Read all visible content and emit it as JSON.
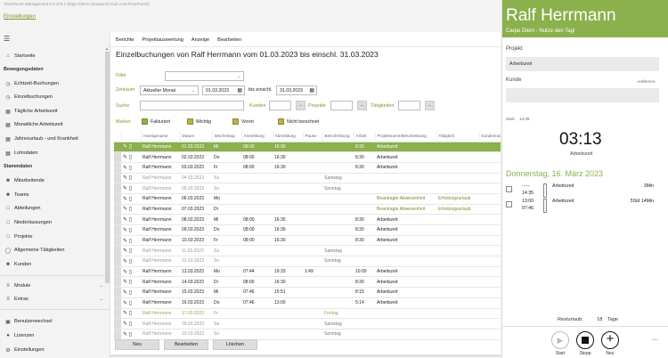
{
  "window": {
    "title": "TimePunch Management 5.0.373.1 (https://demo.timepunch-hub.com/TimePunch)",
    "app_link": "Einstellungen"
  },
  "sidebar": {
    "menu_icon": "hamburger-icon",
    "top_items": [
      {
        "label": "Startseite",
        "icon": "home-icon"
      }
    ],
    "section_bookings": "Bewegungsdaten",
    "booking_items": [
      {
        "label": "Echtzeit-Buchungen",
        "icon": "clock-icon"
      },
      {
        "label": "Einzelbuchungen",
        "icon": "clock-icon"
      },
      {
        "label": "Tägliche Arbeitszeit",
        "icon": "calendar-icon"
      },
      {
        "label": "Monatliche Arbeitszeit",
        "icon": "calendar-icon"
      },
      {
        "label": "Jahresurlaub - und Krankheit",
        "icon": "calendar-icon"
      },
      {
        "label": "Lohndaten",
        "icon": "table-icon"
      }
    ],
    "section_master": "Stammdaten",
    "master_items": [
      {
        "label": "Mitarbeitende",
        "icon": "person-icon"
      },
      {
        "label": "Teams",
        "icon": "team-icon"
      },
      {
        "label": "Abteilungen",
        "icon": "department-icon"
      },
      {
        "label": "Niederlassungen",
        "icon": "building-icon"
      },
      {
        "label": "Projekte",
        "icon": "folder-icon"
      },
      {
        "label": "Allgemeine Tätigkeiten",
        "icon": "activity-icon"
      },
      {
        "label": "Kunden",
        "icon": "customer-icon"
      }
    ],
    "expanders": [
      {
        "label": "Module",
        "icon": "module-icon"
      },
      {
        "label": "Extras",
        "icon": "extras-icon"
      }
    ],
    "bottom_items": [
      {
        "label": "Benutzerwechsel",
        "icon": "switch-user-icon"
      },
      {
        "label": "Lizenzen",
        "icon": "license-icon"
      },
      {
        "label": "Einstellungen",
        "icon": "gear-icon"
      }
    ]
  },
  "main": {
    "menu": [
      "Berichte",
      "Projektauswertung",
      "Anzeige",
      "Bearbeiten"
    ],
    "heading": "Einzelbuchungen von Ralf Herrmann vom 01.03.2023 bis einschl. 31.03.2023",
    "filter": {
      "filter_label": "Filter",
      "zeitraum_label": "Zeitraum",
      "zeitraum_value": "Aktueller Monat",
      "from_date": "01.03.2023",
      "until_label": "bis einschl.",
      "to_date": "31.03.2023",
      "search_label": "Suche",
      "kunden_label": "Kunden",
      "projekte_label": "Projekte",
      "taetigkeiten_label": "Tätigkeiten",
      "dots": "..."
    },
    "markers": {
      "label": "Marker",
      "items": [
        {
          "label": "Fakturiert",
          "style": "white"
        },
        {
          "label": "Wichtig",
          "style": "olive"
        },
        {
          "label": "Vorort",
          "style": "olive"
        },
        {
          "label": "Nicht berechnet",
          "style": "olive"
        }
      ]
    },
    "columns": [
      "",
      "",
      "Anzeigename",
      "Datum",
      "Wochentag",
      "Anmeldung",
      "Abmeldung",
      "Pause",
      "Beschreibung",
      "Arbeit",
      "Projektname/Beschreibung",
      "Tätigkeit",
      "Kundenname"
    ],
    "rows": [
      {
        "name": "Ralf Herrmann",
        "date": "01.03.2023",
        "wd": "Mi",
        "in": "08:00",
        "out": "16:30",
        "pause": "",
        "desc": "",
        "work": "8:30",
        "proj": "Arbeitszeit",
        "act": "",
        "state": "sel"
      },
      {
        "name": "Ralf Herrmann",
        "date": "02.03.2023",
        "wd": "Do",
        "in": "08:00",
        "out": "16:30",
        "pause": "",
        "desc": "",
        "work": "8:30",
        "proj": "Arbeitszeit",
        "act": "",
        "state": ""
      },
      {
        "name": "Ralf Herrmann",
        "date": "03.03.2023",
        "wd": "Fr",
        "in": "08:00",
        "out": "16:30",
        "pause": "",
        "desc": "",
        "work": "8:30",
        "proj": "Arbeitszeit",
        "act": "",
        "state": ""
      },
      {
        "name": "Ralf Herrmann",
        "date": "04.03.2023",
        "wd": "Sa",
        "in": "",
        "out": "",
        "pause": "",
        "desc": "Samstag",
        "work": "",
        "proj": "",
        "act": "",
        "state": "grey"
      },
      {
        "name": "Ralf Herrmann",
        "date": "05.03.2023",
        "wd": "So",
        "in": "",
        "out": "",
        "pause": "",
        "desc": "Sonntag",
        "work": "",
        "proj": "",
        "act": "",
        "state": "grey"
      },
      {
        "name": "Ralf Herrmann",
        "date": "06.03.2023",
        "wd": "Mo",
        "in": "",
        "out": "",
        "pause": "",
        "desc": "",
        "work": "",
        "proj": "Beantragte Abwesenheit",
        "act": "Erholungsurlaub",
        "state": "abs"
      },
      {
        "name": "Ralf Herrmann",
        "date": "07.03.2023",
        "wd": "Di",
        "in": "",
        "out": "",
        "pause": "",
        "desc": "",
        "work": "",
        "proj": "Beantragte Abwesenheit",
        "act": "Erholungsurlaub",
        "state": "abs"
      },
      {
        "name": "Ralf Herrmann",
        "date": "08.03.2023",
        "wd": "Mi",
        "in": "08:00",
        "out": "16:30",
        "pause": "",
        "desc": "",
        "work": "8:30",
        "proj": "Arbeitszeit",
        "act": "",
        "state": ""
      },
      {
        "name": "Ralf Herrmann",
        "date": "09.03.2023",
        "wd": "Do",
        "in": "08:00",
        "out": "16:30",
        "pause": "",
        "desc": "",
        "work": "8:30",
        "proj": "Arbeitszeit",
        "act": "",
        "state": ""
      },
      {
        "name": "Ralf Herrmann",
        "date": "10.03.2023",
        "wd": "Fr",
        "in": "08:00",
        "out": "16:30",
        "pause": "",
        "desc": "",
        "work": "8:30",
        "proj": "Arbeitszeit",
        "act": "",
        "state": ""
      },
      {
        "name": "Ralf Herrmann",
        "date": "11.03.2023",
        "wd": "Sa",
        "in": "",
        "out": "",
        "pause": "",
        "desc": "Samstag",
        "work": "",
        "proj": "",
        "act": "",
        "state": "grey"
      },
      {
        "name": "Ralf Herrmann",
        "date": "12.03.2023",
        "wd": "So",
        "in": "",
        "out": "",
        "pause": "",
        "desc": "Sonntag",
        "work": "",
        "proj": "",
        "act": "",
        "state": "grey"
      },
      {
        "name": "Ralf Herrmann",
        "date": "13.03.2023",
        "wd": "Mo",
        "in": "07:44",
        "out": "19:33",
        "pause": "1:49",
        "desc": "",
        "work": "10:00",
        "proj": "Arbeitszeit",
        "act": "",
        "state": ""
      },
      {
        "name": "Ralf Herrmann",
        "date": "14.03.2023",
        "wd": "Di",
        "in": "08:00",
        "out": "16:30",
        "pause": "",
        "desc": "",
        "work": "8:30",
        "proj": "Arbeitszeit",
        "act": "",
        "state": ""
      },
      {
        "name": "Ralf Herrmann",
        "date": "15.03.2023",
        "wd": "Mi",
        "in": "07:46",
        "out": "15:51",
        "pause": "",
        "desc": "",
        "work": "8:15",
        "proj": "Arbeitszeit",
        "act": "",
        "state": ""
      },
      {
        "name": "Ralf Herrmann",
        "date": "16.03.2023",
        "wd": "Do",
        "in": "07:46",
        "out": "13:00",
        "pause": "",
        "desc": "",
        "work": "5:14",
        "proj": "Arbeitszeit",
        "act": "",
        "state": ""
      },
      {
        "name": "Ralf Herrmann",
        "date": "17.03.2023",
        "wd": "Fr",
        "in": "",
        "out": "",
        "pause": "",
        "desc": "Freitag",
        "work": "",
        "proj": "",
        "act": "",
        "state": "hol"
      },
      {
        "name": "Ralf Herrmann",
        "date": "18.03.2023",
        "wd": "Sa",
        "in": "",
        "out": "",
        "pause": "",
        "desc": "Samstag",
        "work": "",
        "proj": "",
        "act": "",
        "state": "grey"
      },
      {
        "name": "Ralf Herrmann",
        "date": "19.03.2023",
        "wd": "So",
        "in": "",
        "out": "",
        "pause": "",
        "desc": "Sonntag",
        "work": "",
        "proj": "",
        "act": "",
        "state": "grey"
      }
    ],
    "buttons": [
      "Neu",
      "Bearbeiten",
      "Löschen"
    ]
  },
  "panel": {
    "name": "Ralf Herrmann",
    "tagline": "Carpe Diem - Nutze den Tag!",
    "projekt_label": "Projekt",
    "projekt_value": "Arbeitszeit",
    "kunde_label": "Kunde",
    "kunde_hint": "entfernen",
    "start_label": "Start",
    "start_value": "14:35",
    "clock": "03:13",
    "clock_sub": "Arbeitszeit",
    "date": "Donnerstag, 16. März 2023",
    "bookings": [
      {
        "from": "--:--",
        "to": "14:35",
        "name": "Arbeitszeit",
        "dur": "3Min"
      },
      {
        "from": "13:00",
        "to": "07:46",
        "name": "Arbeitszeit",
        "dur": "5Std 14Min"
      }
    ],
    "rest_label": "Resturlaub:",
    "rest_value": "18",
    "rest_unit": "Tage",
    "controls": [
      {
        "label": "Start",
        "icon": "play-icon"
      },
      {
        "label": "Stopp",
        "icon": "stop-icon"
      },
      {
        "label": "Neu",
        "icon": "plus-icon"
      }
    ],
    "more_icon": "more-icon",
    "accent": "#8ab14b"
  }
}
